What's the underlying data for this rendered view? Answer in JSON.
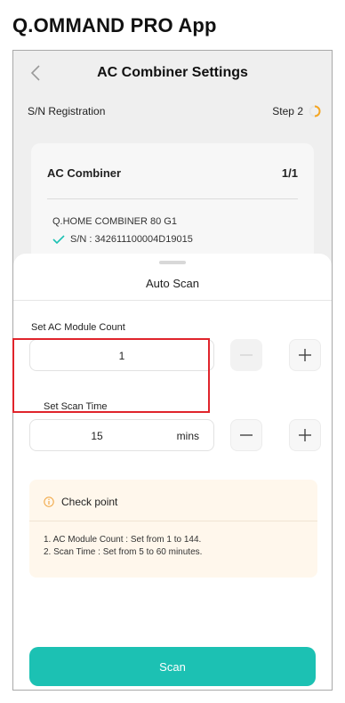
{
  "document": {
    "title": "Q.OMMAND PRO App"
  },
  "nav": {
    "title": "AC Combiner Settings"
  },
  "stepbar": {
    "left_label": "S/N Registration",
    "step_label": "Step 2"
  },
  "card": {
    "title": "AC Combiner",
    "count": "1/1",
    "model": "Q.HOME COMBINER 80 G1",
    "serial": "S/N : 342611100004D19015"
  },
  "sheet": {
    "title": "Auto Scan",
    "module_count": {
      "label": "Set AC Module Count",
      "value": "1"
    },
    "scan_time": {
      "label": "Set Scan Time",
      "value": "15",
      "unit": "mins"
    },
    "checkpoint": {
      "title": "Check point",
      "lines": [
        "1. AC Module Count : Set from 1 to 144.",
        "2. Scan Time : Set from 5 to 60 minutes."
      ]
    },
    "scan_button": "Scan"
  },
  "colors": {
    "accent": "#1cc1b3",
    "step_ring": "#f5a623",
    "highlight": "#e0242b",
    "checkmark": "#1cc1b3",
    "info": "#f0a23b"
  },
  "icons": {
    "back": "chevron-left-icon",
    "step": "progress-ring-icon",
    "check": "check-icon",
    "minus": "minus-icon",
    "plus": "plus-icon",
    "info": "info-circle-icon"
  }
}
